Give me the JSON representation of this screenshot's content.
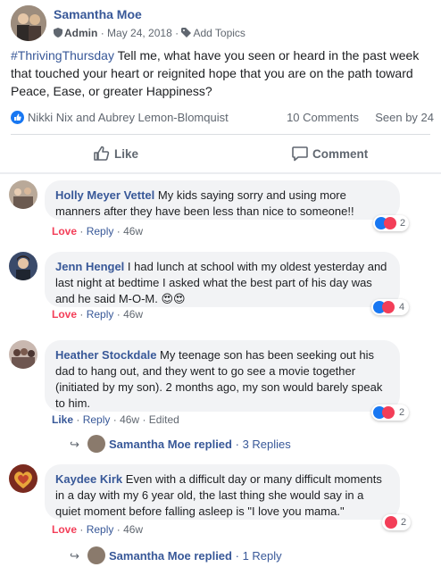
{
  "post": {
    "author": "Samantha Moe",
    "role": "Admin",
    "date": "May 24, 2018",
    "add_topics": "Add Topics",
    "hashtag": "#ThrivingThursday",
    "text": " Tell me, what have you seen or heard in the past week that touched your heart or reignited hope that you are on the path toward Peace, Ease, or greater Happiness?",
    "liked_by": "Nikki Nix and Aubrey Lemon-Blomquist",
    "comments_count": "10 Comments",
    "seen_by": "Seen by 24"
  },
  "actions": {
    "like": "Like",
    "comment": "Comment"
  },
  "meta_sep": "·",
  "comments": [
    {
      "name": "Holly Meyer Vettel",
      "text": " My kids saying sorry and using more manners after they have been less than nice to someone!!",
      "reaction_label": "Love",
      "reply": "Reply",
      "time": "46w",
      "edited": "",
      "reaction_count": "2"
    },
    {
      "name": "Jenn Hengel",
      "text": " I had lunch at school with my oldest yesterday and last night at bedtime I asked what the best part of his day was and he said M-O-M. 😍😍",
      "reaction_label": "Love",
      "reply": "Reply",
      "time": "46w",
      "edited": "",
      "reaction_count": "4"
    },
    {
      "name": "Heather Stockdale",
      "text": " My teenage son has been seeking out his dad to hang out, and they went to go see a movie together (initiated by my son). 2 months ago, my son would barely speak to him.",
      "reaction_label": "Like",
      "reply": "Reply",
      "time": "46w",
      "edited": "Edited",
      "reaction_count": "2",
      "replies": {
        "who": "Samantha Moe replied",
        "count": "3 Replies"
      }
    },
    {
      "name": "Kaydee Kirk",
      "text": " Even with a difficult day or many difficult moments in a day with my 6 year old, the last thing she would say in a quiet moment before falling asleep is \"I love you mama.\"",
      "reaction_label": "Love",
      "reply": "Reply",
      "time": "46w",
      "edited": "",
      "reaction_count": "2",
      "replies": {
        "who": "Samantha Moe replied",
        "count": "1 Reply"
      }
    }
  ],
  "colors": {
    "link": "#385898",
    "love": "#f33e58",
    "like": "#1877f2",
    "bubble": "#f2f3f5"
  },
  "icons": [
    "shield-icon",
    "tag-icon",
    "thumbs-up-icon",
    "comment-icon",
    "heart-icon",
    "reply-arrow-icon"
  ]
}
